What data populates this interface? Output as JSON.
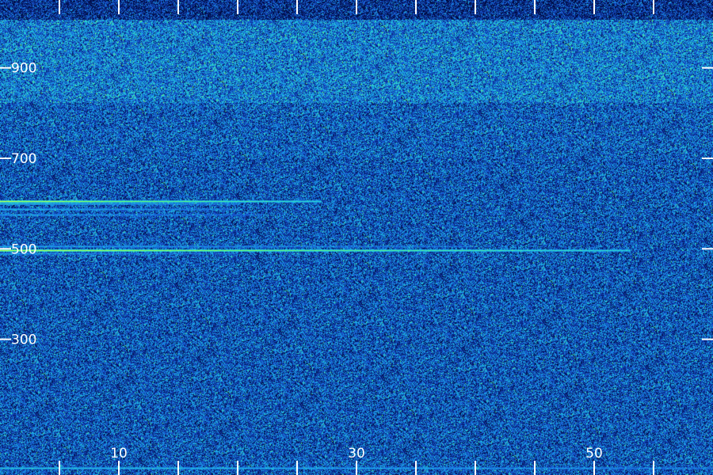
{
  "chart_data": {
    "type": "heatmap",
    "title": "",
    "xlabel": "",
    "ylabel": "",
    "xlim": [
      0,
      60
    ],
    "ylim": [
      0,
      1050
    ],
    "x_ticks": [
      0,
      5,
      10,
      15,
      20,
      25,
      30,
      35,
      40,
      45,
      50,
      55
    ],
    "x_tick_labels": [
      {
        "value": 10,
        "text": "10"
      },
      {
        "value": 30,
        "text": "30"
      },
      {
        "value": 50,
        "text": "50"
      }
    ],
    "y_ticks": [
      300,
      500,
      700,
      900
    ],
    "y_tick_labels": [
      {
        "value": 300,
        "text": "300"
      },
      {
        "value": 500,
        "text": "500"
      },
      {
        "value": 700,
        "text": "700"
      },
      {
        "value": 900,
        "text": "900"
      }
    ],
    "grid": false,
    "colormap": [
      "#000a3c",
      "#0a2a8c",
      "#1a5ad8",
      "#18a8e8",
      "#30e0c8",
      "#70ff60",
      "#d8ff40"
    ],
    "background": "#000a3c",
    "horizontal_lines": [
      {
        "y": 605,
        "x_start": 0,
        "x_end": 27,
        "intensity": 0.95
      },
      {
        "y": 600,
        "x_start": 0,
        "x_end": 20,
        "intensity": 0.6
      },
      {
        "y": 588,
        "x_start": 0,
        "x_end": 20,
        "intensity": 0.55
      },
      {
        "y": 575,
        "x_start": 0,
        "x_end": 22,
        "intensity": 0.5
      },
      {
        "y": 505,
        "x_start": 0,
        "x_end": 40,
        "intensity": 0.5
      },
      {
        "y": 497,
        "x_start": 0,
        "x_end": 53,
        "intensity": 0.95
      },
      {
        "y": 490,
        "x_start": 0,
        "x_end": 20,
        "intensity": 0.45
      },
      {
        "y": 15,
        "x_start": 0,
        "x_end": 60,
        "intensity": 0.6
      }
    ]
  }
}
